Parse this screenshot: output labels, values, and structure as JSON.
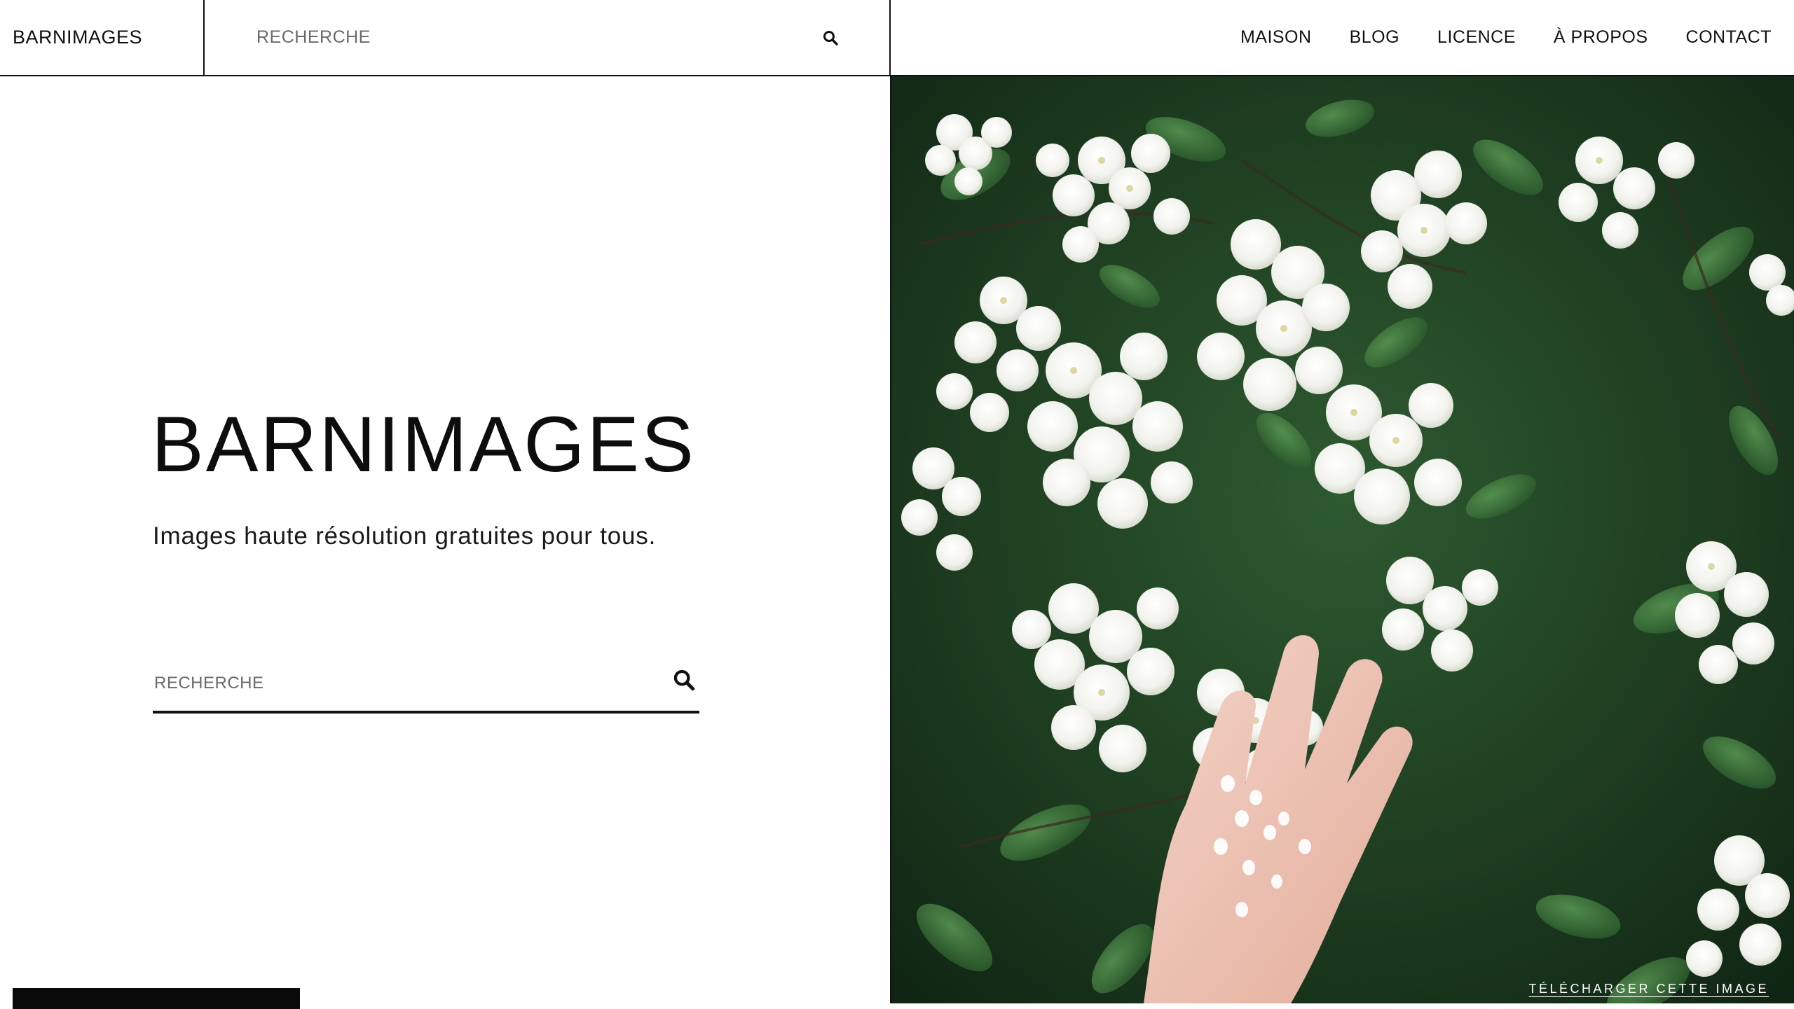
{
  "header": {
    "brand": "BARNIMAGES",
    "search_placeholder": "RECHERCHE",
    "search_icon": "search-icon",
    "nav": [
      {
        "label": "MAISON"
      },
      {
        "label": "BLOG"
      },
      {
        "label": "LICENCE"
      },
      {
        "label": "À PROPOS"
      },
      {
        "label": "CONTACT"
      }
    ]
  },
  "hero": {
    "title": "BARNIMAGES",
    "subtitle": "Images haute résolution gratuites pour tous.",
    "search_placeholder": "RECHERCHE",
    "search_icon": "search-icon"
  },
  "image_panel": {
    "download_label": "TÉLÉCHARGER CETTE IMAGE"
  },
  "colors": {
    "text": "#0f0f0f",
    "background": "#ffffff",
    "border": "#111111",
    "foliage": "#1f3a22"
  }
}
